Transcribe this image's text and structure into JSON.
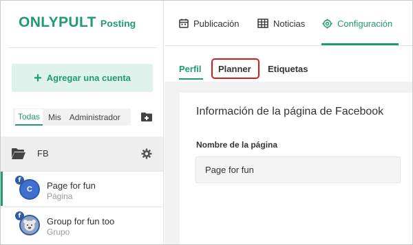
{
  "brand": {
    "name": "ONLYPULT",
    "product": "Posting"
  },
  "sidebar": {
    "add_account_label": "Agregar una cuenta",
    "filters": [
      "Todas",
      "Mis",
      "Administrador"
    ],
    "active_filter": "Todas",
    "group": {
      "label": "FB"
    },
    "accounts": [
      {
        "name": "Page for fun",
        "type": "Página",
        "avatar_letter": "C",
        "network": "f"
      },
      {
        "name": "Group for fun too",
        "type": "Grupo",
        "avatar_letter": "",
        "network": "f"
      }
    ]
  },
  "topnav": {
    "items": [
      "Publicación",
      "Noticias",
      "Configuración"
    ],
    "active": "Configuración"
  },
  "subtabs": {
    "items": [
      "Perfil",
      "Planner",
      "Etiquetas"
    ],
    "active": "Perfil",
    "highlighted": "Planner"
  },
  "panel": {
    "title": "Información de la página de Facebook",
    "field_label": "Nombre de la página",
    "field_value": "Page for fun"
  },
  "colors": {
    "accent": "#1f9b74",
    "highlight": "#d41b1b",
    "facebook": "#2f5aa8"
  }
}
